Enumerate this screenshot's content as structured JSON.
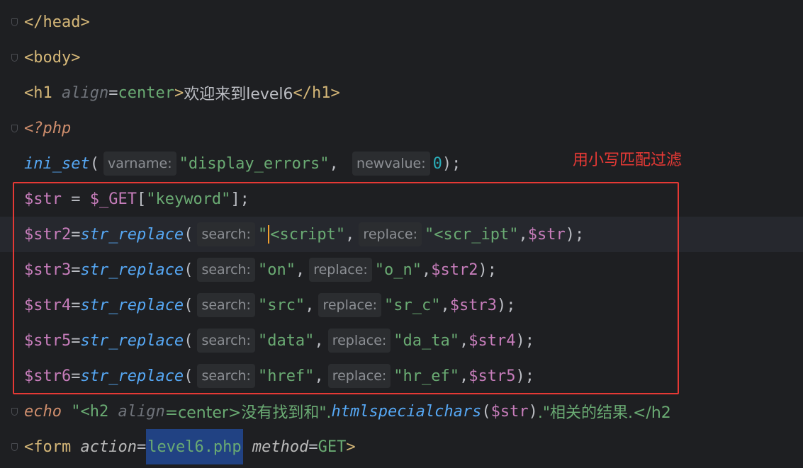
{
  "annotation": "用小写匹配过滤",
  "lines": {
    "l1": {
      "open": "</",
      "tag": "head",
      "close": ">"
    },
    "l2": {
      "open": "<",
      "tag": "body",
      "close": ">"
    },
    "l3": {
      "open": "<",
      "tag": "h1",
      "attr": "align",
      "eq": "=",
      "val": "center",
      "close": ">",
      "text": "欢迎来到level6",
      "endopen": "</",
      "endtag": "h1",
      "endclose": ">"
    },
    "l4": {
      "php": "<?php"
    },
    "l5": {
      "fn": "ini_set",
      "paren": "(",
      "hint1": "varname:",
      "str1": "\"display_errors\"",
      "comma": ",",
      "hint2": "newvalue:",
      "num": "0",
      "end": ");"
    },
    "l6": {
      "var1": "$str",
      "eq": " = ",
      "var2": "$_GET",
      "b1": "[",
      "str": "\"keyword\"",
      "b2": "];"
    },
    "l7": {
      "var": "$str2",
      "eq": "=",
      "fn": "str_replace",
      "paren": "(",
      "hint1": "search:",
      "str1a": "\"",
      "str1b": "<script\"",
      "comma": ",",
      "hint2": "replace:",
      "str2": "\"<scr_ipt\"",
      "comma2": ",",
      "var2": "$str",
      "end": ");"
    },
    "l8": {
      "var": "$str3",
      "eq": "=",
      "fn": "str_replace",
      "paren": "(",
      "hint1": "search:",
      "str1": "\"on\"",
      "comma": ",",
      "hint2": "replace:",
      "str2": "\"o_n\"",
      "comma2": ",",
      "var2": "$str2",
      "end": ");"
    },
    "l9": {
      "var": "$str4",
      "eq": "=",
      "fn": "str_replace",
      "paren": "(",
      "hint1": "search:",
      "str1": "\"src\"",
      "comma": ",",
      "hint2": "replace:",
      "str2": "\"sr_c\"",
      "comma2": ",",
      "var2": "$str3",
      "end": ");"
    },
    "l10": {
      "var": "$str5",
      "eq": "=",
      "fn": "str_replace",
      "paren": "(",
      "hint1": "search:",
      "str1": "\"data\"",
      "comma": ",",
      "hint2": "replace:",
      "str2": "\"da_ta\"",
      "comma2": ",",
      "var2": "$str4",
      "end": ");"
    },
    "l11": {
      "var": "$str6",
      "eq": "=",
      "fn": "str_replace",
      "paren": "(",
      "hint1": "search:",
      "str1": "\"href\"",
      "comma": ",",
      "hint2": "replace:",
      "str2": "\"hr_ef\"",
      "comma2": ",",
      "var2": "$str5",
      "end": ");"
    },
    "l12": {
      "kw": "echo",
      "s1": " \"<h2 ",
      "attr": "align",
      "s2": "=center>没有找到和\".",
      "fn": "htmlspecialchars",
      "p1": "(",
      "var": "$str",
      "p2": ")",
      "s3": ".\"相关的结果.</h2"
    },
    "l13": {
      "open": "<",
      "tag": "form",
      "attr1": "action",
      "eq1": "=",
      "val1": "level6.php",
      "attr2": "method",
      "eq2": "=",
      "val2": "GET",
      "close": ">"
    }
  }
}
